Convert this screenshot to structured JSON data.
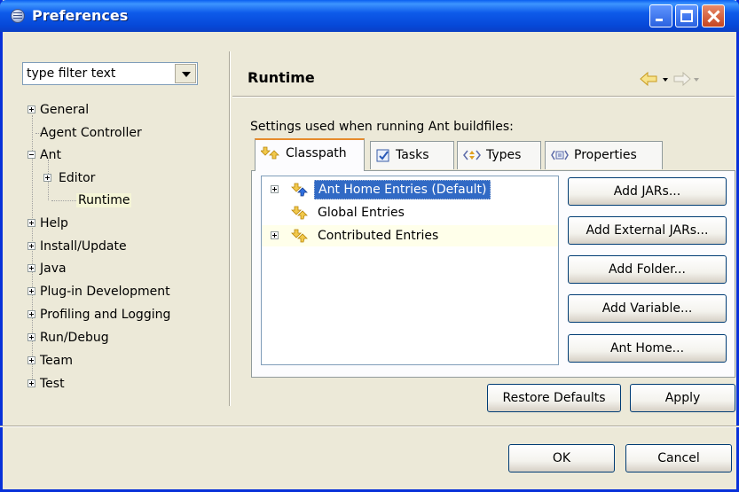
{
  "window": {
    "title": "Preferences"
  },
  "sidebar": {
    "filter": {
      "value": "type filter text"
    },
    "tree": [
      {
        "label": "General",
        "expander": "plus"
      },
      {
        "label": "Agent Controller",
        "expander": "none"
      },
      {
        "label": "Ant",
        "expander": "minus"
      },
      {
        "label": "Editor",
        "expander": "plus"
      },
      {
        "label": "Runtime",
        "expander": "none",
        "selected": true
      },
      {
        "label": "Help",
        "expander": "plus"
      },
      {
        "label": "Install/Update",
        "expander": "plus"
      },
      {
        "label": "Java",
        "expander": "plus"
      },
      {
        "label": "Plug-in Development",
        "expander": "plus"
      },
      {
        "label": "Profiling and Logging",
        "expander": "plus"
      },
      {
        "label": "Run/Debug",
        "expander": "plus"
      },
      {
        "label": "Team",
        "expander": "plus"
      },
      {
        "label": "Test",
        "expander": "plus"
      }
    ]
  },
  "page": {
    "title": "Runtime",
    "description": "Settings used when running Ant buildfiles:",
    "tabs": [
      {
        "label": "Classpath",
        "icon": "classpath-icon",
        "active": true
      },
      {
        "label": "Tasks",
        "icon": "tasks-icon"
      },
      {
        "label": "Types",
        "icon": "types-icon"
      },
      {
        "label": "Properties",
        "icon": "properties-icon"
      }
    ],
    "classpath_entries": [
      {
        "label": "Ant Home Entries (Default)",
        "expander": "plus",
        "selected": true
      },
      {
        "label": "Global Entries",
        "expander": "none"
      },
      {
        "label": "Contributed Entries",
        "expander": "plus"
      }
    ],
    "side_buttons": [
      "Add JARs...",
      "Add External JARs...",
      "Add Folder...",
      "Add Variable...",
      "Ant Home..."
    ],
    "restore_defaults": "Restore Defaults",
    "apply": "Apply"
  },
  "footer": {
    "ok": "OK",
    "cancel": "Cancel"
  },
  "colors": {
    "titlebar": "#0a5ff0",
    "selection": "#316ac5",
    "tab_accent": "#e68b2c",
    "background": "#ece9d8"
  }
}
